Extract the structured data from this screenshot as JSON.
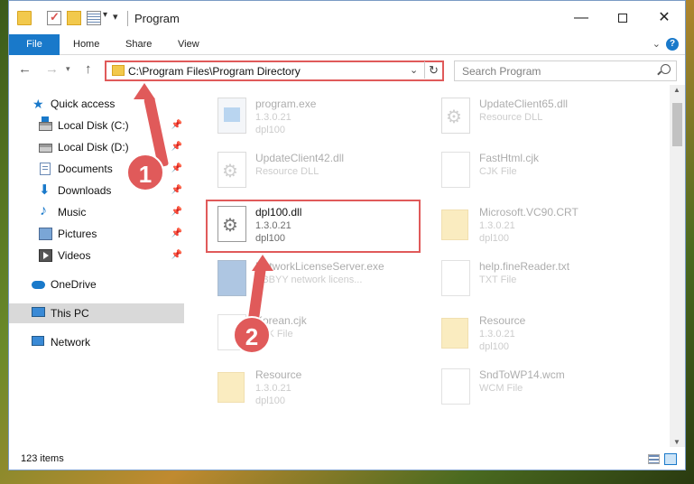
{
  "window": {
    "title": "Program"
  },
  "ribbon": {
    "file": "File",
    "home": "Home",
    "share": "Share",
    "view": "View"
  },
  "address": {
    "path": "C:\\Program Files\\Program Directory"
  },
  "search": {
    "placeholder": "Search Program"
  },
  "sidebar": {
    "items": [
      {
        "label": "Quick access",
        "icon": "star-icon"
      },
      {
        "label": "Local Disk (C:)",
        "icon": "drive-icon",
        "pinned": true
      },
      {
        "label": "Local Disk (D:)",
        "icon": "drive-icon",
        "pinned": true
      },
      {
        "label": "Documents",
        "icon": "documents-icon",
        "pinned": true
      },
      {
        "label": "Downloads",
        "icon": "download-icon",
        "pinned": true
      },
      {
        "label": "Music",
        "icon": "music-icon",
        "pinned": true
      },
      {
        "label": "Pictures",
        "icon": "pictures-icon",
        "pinned": true
      },
      {
        "label": "Videos",
        "icon": "videos-icon",
        "pinned": true
      },
      {
        "label": "OneDrive",
        "icon": "onedrive-icon"
      },
      {
        "label": "This PC",
        "icon": "pc-icon",
        "selected": true
      },
      {
        "label": "Network",
        "icon": "network-icon"
      }
    ]
  },
  "files": [
    {
      "name": "program.exe",
      "meta1": "1.3.0.21",
      "meta2": "dpl100",
      "icon": "exe-icon"
    },
    {
      "name": "UpdateClient65.dll",
      "meta1": "Resource DLL",
      "meta2": "",
      "icon": "dll-icon"
    },
    {
      "name": "UpdateClient42.dll",
      "meta1": "Resource DLL",
      "meta2": "",
      "icon": "dll-icon"
    },
    {
      "name": "FastHtml.cjk",
      "meta1": "CJK File",
      "meta2": "",
      "icon": "file-icon"
    },
    {
      "name": "dpl100.dll",
      "meta1": "1.3.0.21",
      "meta2": "dpl100",
      "icon": "dll-icon"
    },
    {
      "name": "Microsoft.VC90.CRT",
      "meta1": "1.3.0.21",
      "meta2": "dpl100",
      "icon": "folder-icon"
    },
    {
      "name": "NetworkLicenseServer.exe",
      "meta1": "ABBYY network licens...",
      "meta2": "",
      "icon": "exe-icon"
    },
    {
      "name": "help.fineReader.txt",
      "meta1": "TXT File",
      "meta2": "",
      "icon": "file-icon"
    },
    {
      "name": "Korean.cjk",
      "meta1": "CJK File",
      "meta2": "",
      "icon": "file-icon"
    },
    {
      "name": "Resource",
      "meta1": "1.3.0.21",
      "meta2": "dpl100",
      "icon": "folder-icon"
    },
    {
      "name": "Resource",
      "meta1": "1.3.0.21",
      "meta2": "dpl100",
      "icon": "folder-icon"
    },
    {
      "name": "SndToWP14.wcm",
      "meta1": "WCM File",
      "meta2": "",
      "icon": "file-icon"
    }
  ],
  "callouts": {
    "one": "1",
    "two": "2"
  },
  "status": {
    "items": "123 items"
  }
}
